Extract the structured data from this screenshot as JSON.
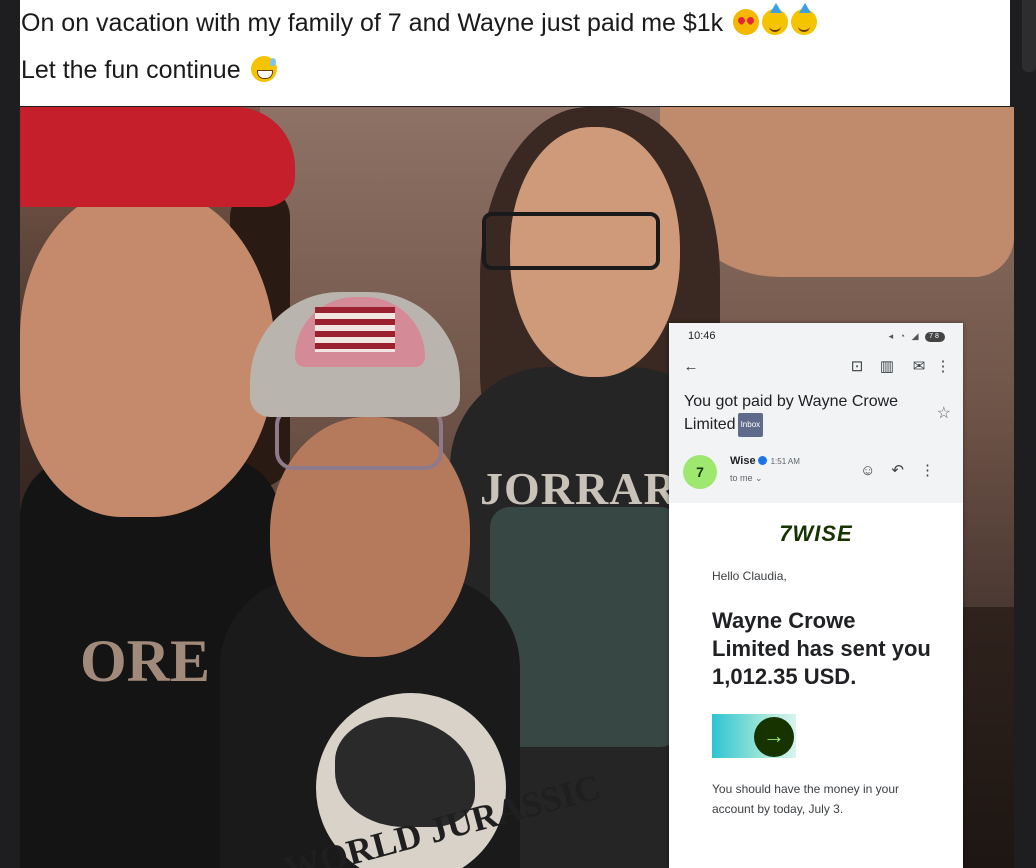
{
  "post": {
    "caption_line1": "On on vacation with my family of 7 and Wayne just paid me $1k",
    "caption_line2": "Let the fun continue",
    "emojis_line1": [
      "smiling-face-with-heart-eyes",
      "partying-face",
      "partying-face"
    ],
    "emojis_line2": [
      "grinning-face-with-sweat"
    ]
  },
  "photo": {
    "shirt_text_right": "JORRAR",
    "shirt_text_left": "ORE",
    "shirt_text_center": "WORLD JURASSIC"
  },
  "phone": {
    "status_time": "10:46",
    "battery": "78",
    "subject": "You got paid by Wayne Crowe Limited",
    "label": "Inbox",
    "sender_initial": "7",
    "sender_name": "Wise",
    "sent_time": "1:51 AM",
    "recipient": "to me",
    "brand": "7WISE",
    "greeting": "Hello Claudia,",
    "headline": "Wayne Crowe Limited has sent you 1,012.35 USD.",
    "note": "You should have the money in your account by today, July 3.",
    "colors": {
      "wise_green": "#9fe870",
      "wise_dark": "#163300"
    }
  }
}
